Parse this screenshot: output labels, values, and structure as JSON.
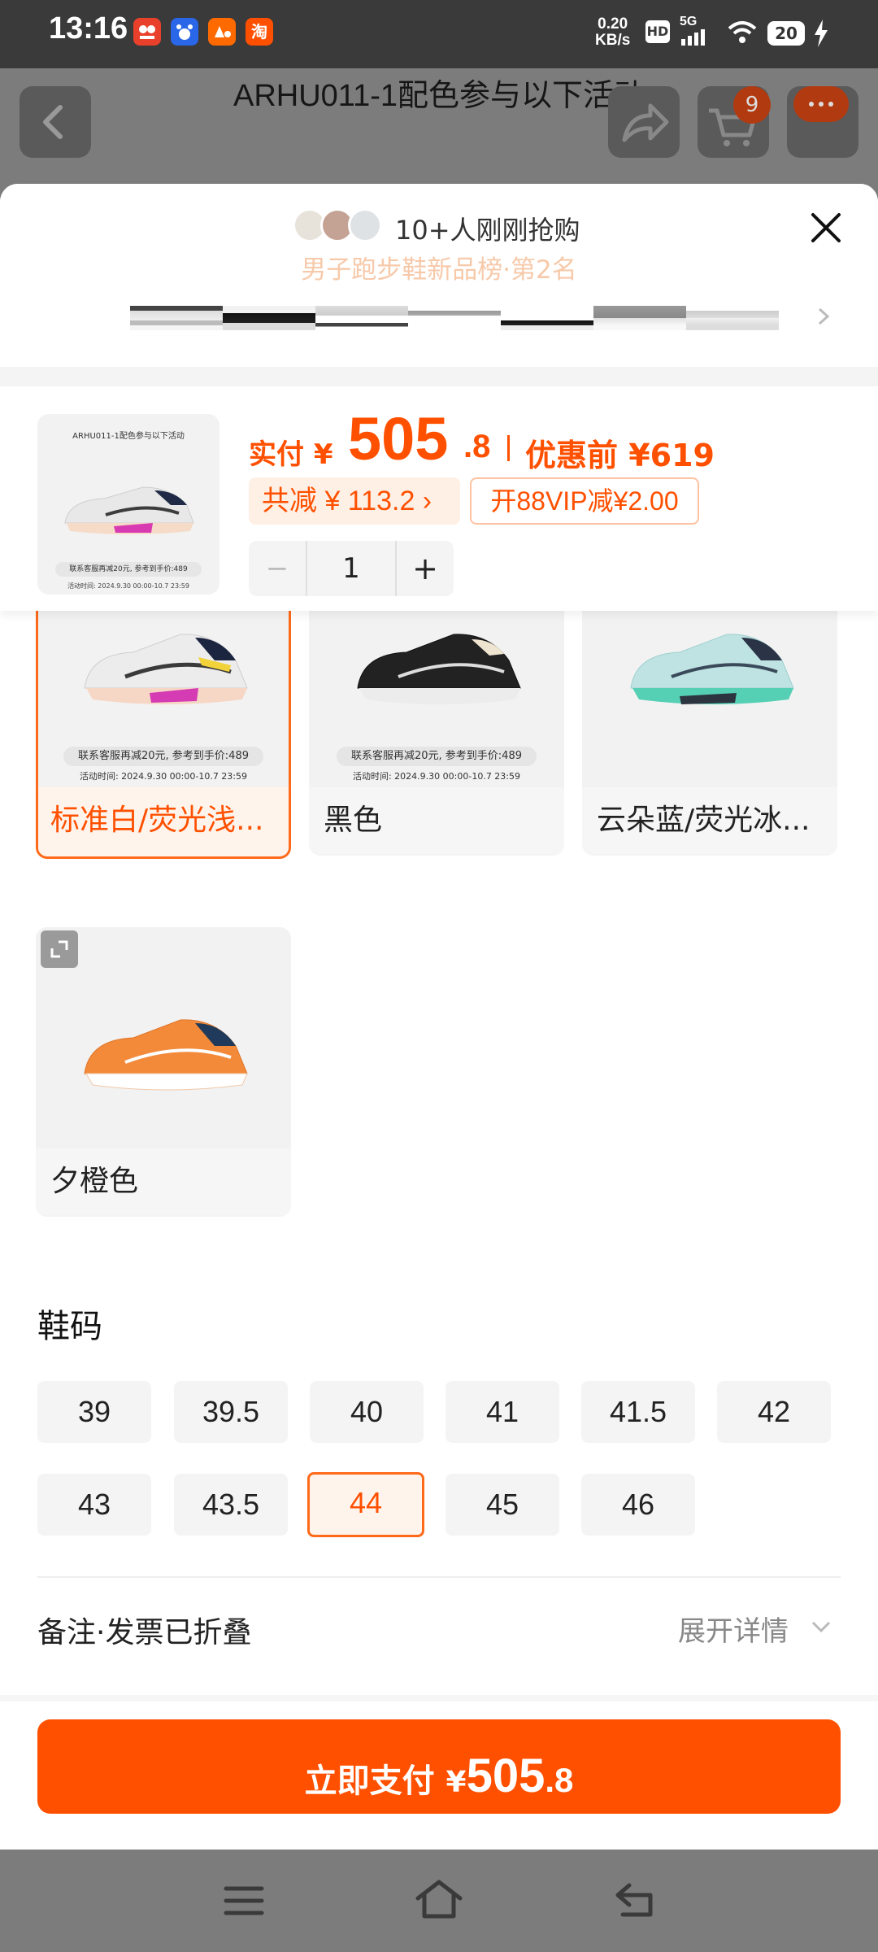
{
  "status_bar": {
    "time": "13:16",
    "net_speed_value": "0.20",
    "net_speed_unit": "KB/s",
    "hd_label": "HD",
    "network_label": "5G",
    "battery": "20",
    "app_icons": [
      "app-a-icon",
      "baidu-icon",
      "app-c-icon",
      "taobao-icon"
    ],
    "app_icon_glyphs": [
      "",
      "",
      "",
      "淘"
    ]
  },
  "header": {
    "title": "ARHU011-1配色参与以下活动",
    "cart_badge": "9"
  },
  "rank": {
    "buyers_text": "10+人刚刚抢购",
    "rank_text": "男子跑步鞋新品榜·第2名"
  },
  "summary": {
    "thumb_caption": "ARHU011-1配色参与以下活动",
    "thumb_promo": "联系客服再减20元, 参考到手价:489",
    "thumb_date": "活动时间: 2024.9.30 00:00-10.7 23:59",
    "price_label": "实付 ¥",
    "price_int": "505",
    "price_dec": ".8",
    "orig_price": "优惠前 ¥619",
    "discount_text": "共减 ¥ 113.2 ›",
    "vip_text": "开88VIP减¥2.00",
    "quantity": "1",
    "minus": "−",
    "plus": "+"
  },
  "colors": [
    {
      "label": "标准白/荧光浅...",
      "selected": true,
      "promo": "联系客服再减20元,  参考到手价:489",
      "date": "活动时间:  2024.9.30 00:00-10.7 23:59"
    },
    {
      "label": "黑色",
      "selected": false,
      "promo": "联系客服再减20元,  参考到手价:489",
      "date": "活动时间:  2024.9.30 00:00-10.7 23:59"
    },
    {
      "label": "云朵蓝/荧光冰...",
      "selected": false
    },
    {
      "label": "夕橙色",
      "selected": false
    }
  ],
  "size_section": {
    "title": "鞋码",
    "sizes": [
      "39",
      "39.5",
      "40",
      "41",
      "41.5",
      "42",
      "43",
      "43.5",
      "44",
      "45",
      "46"
    ],
    "selected": "44"
  },
  "note": {
    "label": "备注·发票已折叠",
    "expand": "展开详情"
  },
  "pay": {
    "label": "立即支付",
    "currency": "¥",
    "amount_int": "505",
    "amount_dec": ".8"
  },
  "colors_theme": {
    "accent": "#ff5000",
    "accent_light": "#fff4ec"
  }
}
